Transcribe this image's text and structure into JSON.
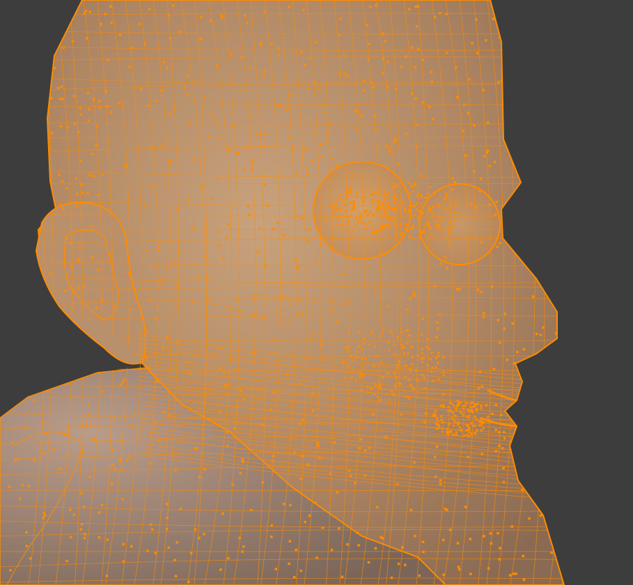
{
  "viewport": {
    "background_color": "#3d3d3d",
    "mesh_fill_color": "#b9916a",
    "wire_color": "#ff8c00",
    "vertex_color": "#ff8c00",
    "mode": "edit-mode-wireframe-overlay"
  },
  "mesh": {
    "selection": "all-vertices-selected",
    "parts": [
      {
        "name": "head-icon"
      },
      {
        "name": "ear-icon"
      },
      {
        "name": "eye-icon"
      },
      {
        "name": "shoulders-icon"
      }
    ]
  }
}
